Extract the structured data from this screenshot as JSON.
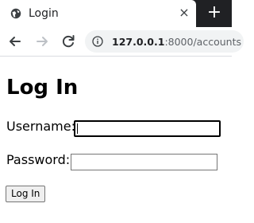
{
  "browser": {
    "tab": {
      "title": "Login",
      "close_glyph": "×",
      "favicon": "globe-icon"
    },
    "new_tab_glyph": "+",
    "toolbar": {
      "url_host": "127.0.0.1",
      "url_rest": ":8000/accounts",
      "icons": [
        "back-arrow-icon",
        "forward-arrow-icon",
        "reload-icon",
        "info-icon"
      ]
    }
  },
  "page": {
    "heading": "Log In",
    "form": {
      "username_label": "Username:",
      "username_value": "",
      "password_label": "Password:",
      "password_value": "",
      "submit_label": "Log In"
    }
  },
  "colors": {
    "tabstrip_bg": "#202124",
    "omnibox_bg": "#f1f3f4",
    "focus_border": "#000000"
  }
}
